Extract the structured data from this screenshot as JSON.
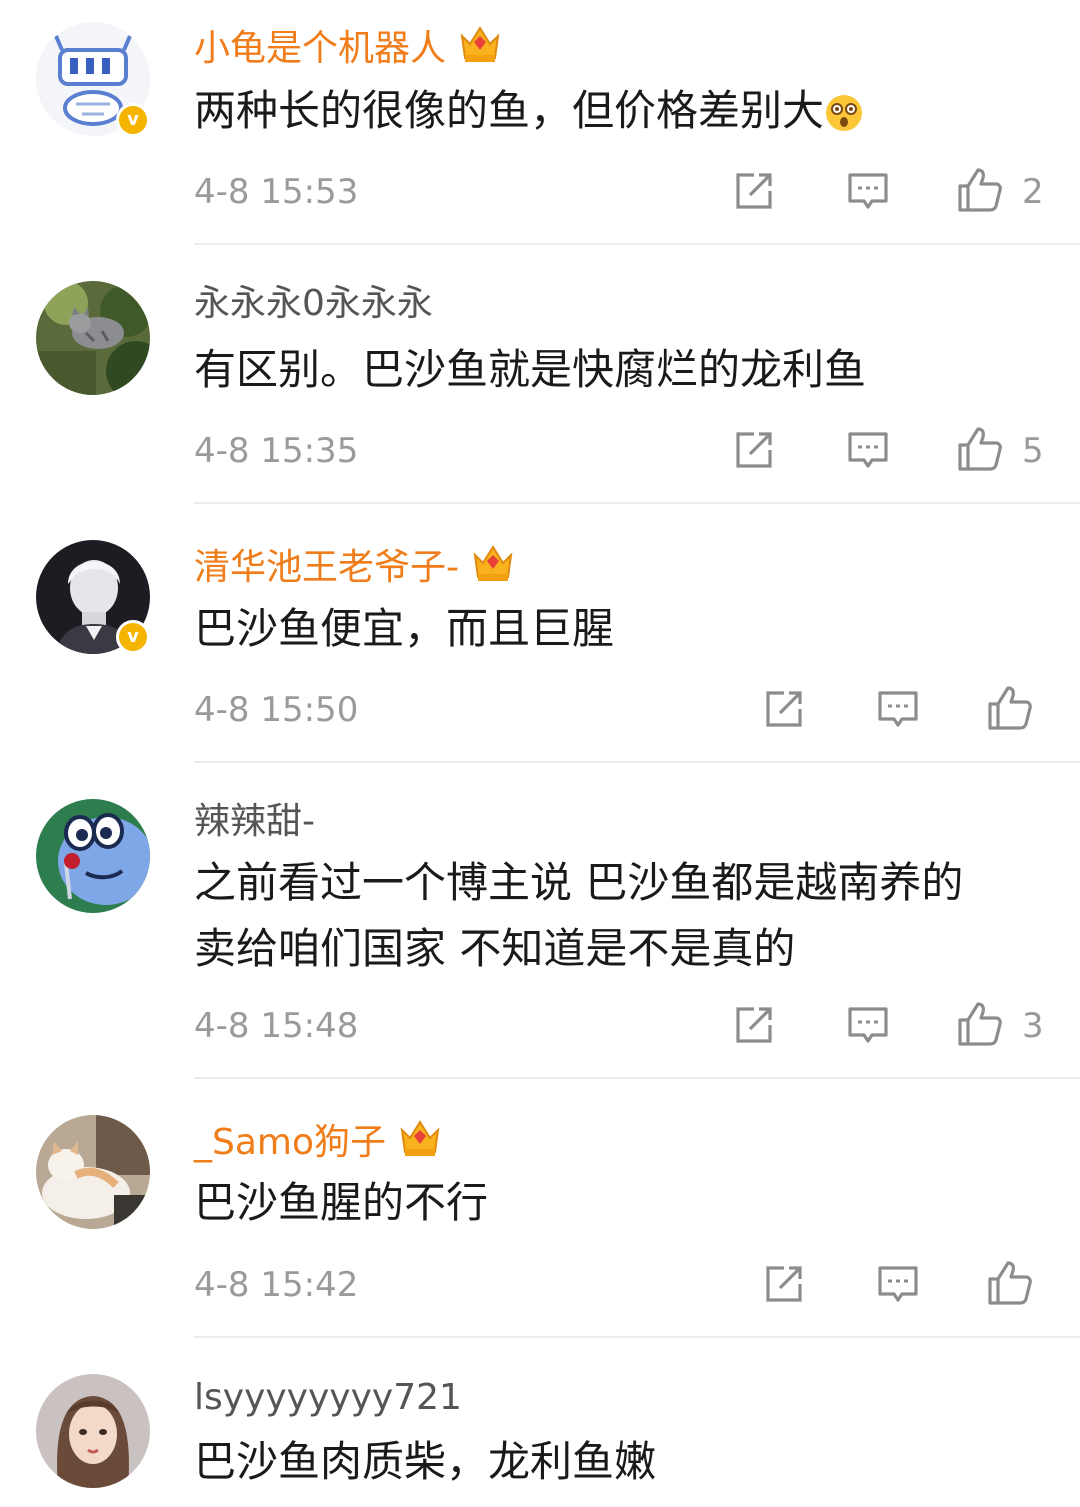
{
  "comments": [
    {
      "user": "小龟是个机器人",
      "text": "两种长的很像的鱼，但价格差别大",
      "emoji": "dizzy-face-emoji",
      "time": "4-8 15:53",
      "likes": "2",
      "verified": true,
      "crown": true
    },
    {
      "user": "永永永0永永永",
      "text": "有区别。巴沙鱼就是快腐烂的龙利鱼",
      "time": "4-8 15:35",
      "likes": "5",
      "verified": false,
      "crown": false
    },
    {
      "user": "清华池王老爷子-",
      "text": "巴沙鱼便宜，而且巨腥",
      "time": "4-8 15:50",
      "likes": "",
      "verified": true,
      "crown": true
    },
    {
      "user": "辣辣甜-",
      "text_line1": "之前看过一个博主说 巴沙鱼都是越南养的",
      "text_line2": "卖给咱们国家 不知道是不是真的",
      "time": "4-8 15:48",
      "likes": "3",
      "verified": false,
      "crown": false
    },
    {
      "user": "_Samo狗子",
      "text": "巴沙鱼腥的不行",
      "time": "4-8 15:42",
      "likes": "",
      "verified": false,
      "crown": true
    },
    {
      "user": "lsyyyyyyyy721",
      "text": "巴沙鱼肉质柴，龙利鱼嫩",
      "verified": false,
      "crown": false
    }
  ],
  "icons": {
    "share": "share-icon",
    "reply": "comment-icon",
    "like": "thumbs-up-icon",
    "verified": "verified-badge-icon",
    "crown": "crown-icon"
  },
  "colors": {
    "vip_name": "#f07c1a",
    "plain_name": "#555555",
    "meta": "#9a9a9a",
    "verified_badge": "#f5b400"
  },
  "badge": {
    "verified_glyph": "v"
  }
}
